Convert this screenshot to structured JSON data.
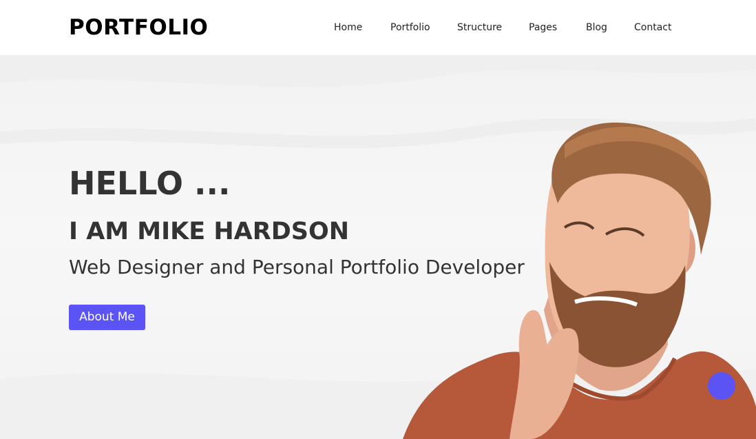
{
  "header": {
    "logo": "PORTFOLIO",
    "nav": [
      "Home",
      "Portfolio",
      "Structure",
      "Pages",
      "Blog",
      "Contact"
    ]
  },
  "hero": {
    "greeting": "HELLO ...",
    "name": "I AM MIKE HARDSON",
    "role": "Web Designer and Personal Portfolio Developer",
    "button_label": "About Me"
  },
  "colors": {
    "accent": "#5b53f4",
    "text": "#333333",
    "background": "#f5f5f5"
  },
  "icons": {
    "scroll_top": "circle-button"
  }
}
